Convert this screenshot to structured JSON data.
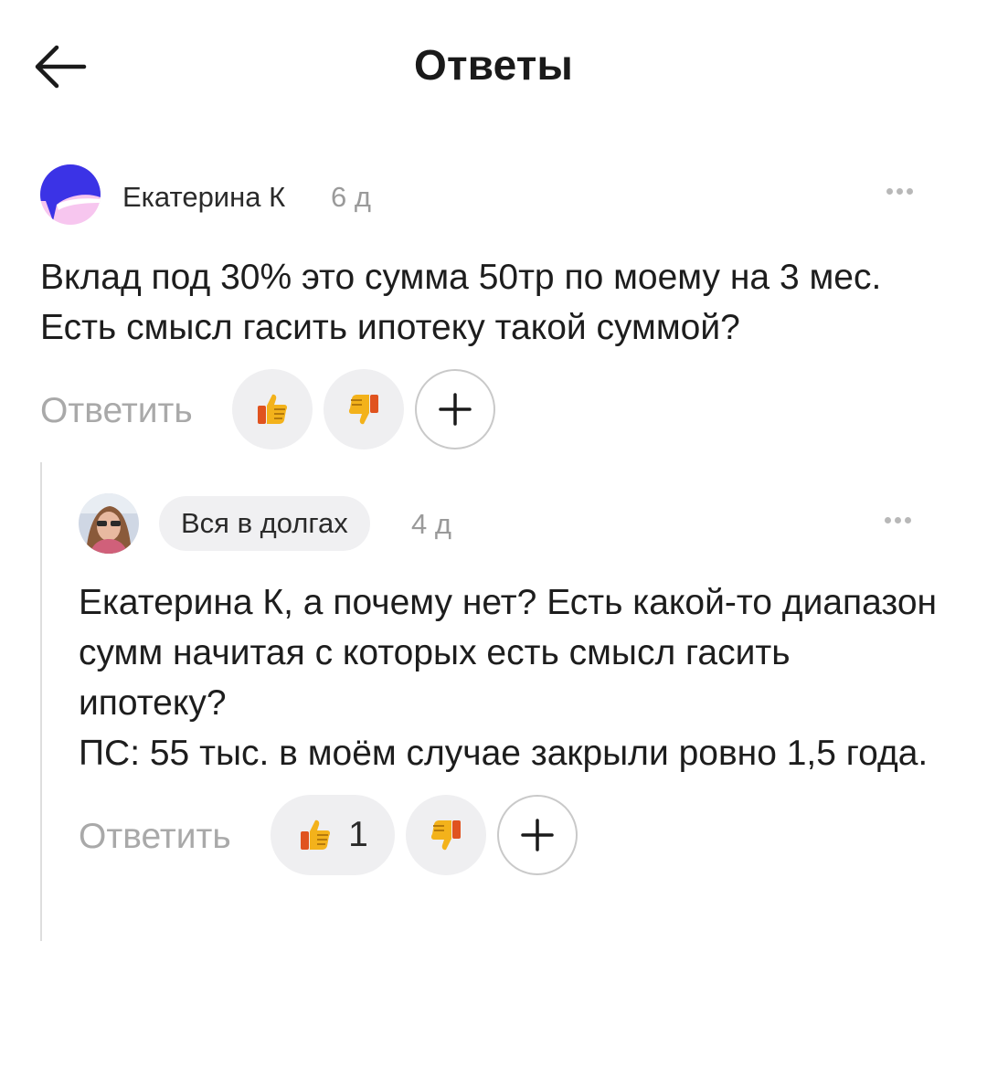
{
  "header": {
    "title": "Ответы",
    "back_icon": "arrow-left-icon"
  },
  "comments": [
    {
      "author": "Екатерина К",
      "time": "6 д",
      "text": "Вклад под 30% это сумма 50тр по моему на 3 мес. Есть смысл гасить ипотеку такой суммой?",
      "reply_label": "Ответить",
      "likes": "",
      "more_icon": "more-dots-icon"
    },
    {
      "author": "Вся в долгах",
      "time": "4 д",
      "text": "Екатерина К, а почему нет? Есть какой-то диапазон сумм начитая с которых есть смысл гасить ипотеку?\nПС: 55 тыс. в моём случае закрыли ровно 1,5 года.",
      "reply_label": "Ответить",
      "likes": "1",
      "more_icon": "more-dots-icon"
    }
  ],
  "colors": {
    "accent_blue": "#3b33e6",
    "pill_bg": "#efeff1",
    "muted_text": "#a9a9a9"
  }
}
